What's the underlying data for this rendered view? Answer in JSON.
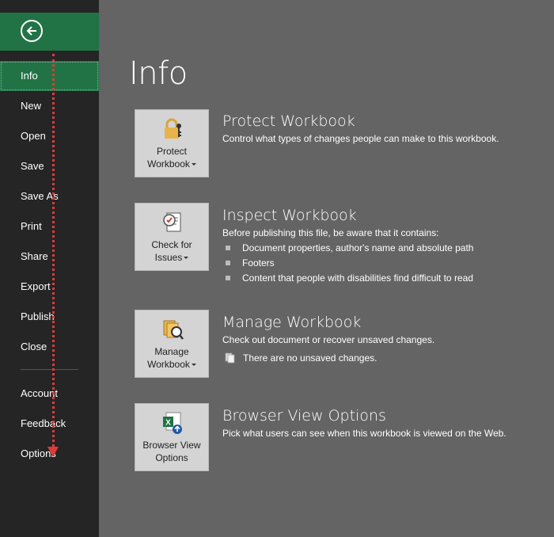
{
  "nav": {
    "items": [
      {
        "label": "Info"
      },
      {
        "label": "New"
      },
      {
        "label": "Open"
      },
      {
        "label": "Save"
      },
      {
        "label": "Save As"
      },
      {
        "label": "Print"
      },
      {
        "label": "Share"
      },
      {
        "label": "Export"
      },
      {
        "label": "Publish"
      },
      {
        "label": "Close"
      },
      {
        "label": "Account"
      },
      {
        "label": "Feedback"
      },
      {
        "label": "Options"
      }
    ]
  },
  "main": {
    "title": "Info",
    "sections": [
      {
        "tile_line1": "Protect",
        "tile_line2": "Workbook",
        "title": "Protect Workbook",
        "description": "Control what types of changes people can make to this workbook."
      },
      {
        "tile_line1": "Check for",
        "tile_line2": "Issues",
        "title": "Inspect Workbook",
        "description": "Before publishing this file, be aware that it contains:",
        "bullets": [
          "Document properties, author's name and absolute path",
          "Footers",
          "Content that people with disabilities find difficult to read"
        ]
      },
      {
        "tile_line1": "Manage",
        "tile_line2": "Workbook",
        "title": "Manage Workbook",
        "description": "Check out document or recover unsaved changes.",
        "note": "There are no unsaved changes."
      },
      {
        "tile_line1": "Browser View",
        "tile_line2": "Options",
        "title": "Browser View Options",
        "description": "Pick what users can see when this workbook is viewed on the Web."
      }
    ]
  },
  "colors": {
    "accent": "#217346",
    "sidebar": "#252525",
    "content_bg": "#646464",
    "annotation": "#e03a3a"
  }
}
